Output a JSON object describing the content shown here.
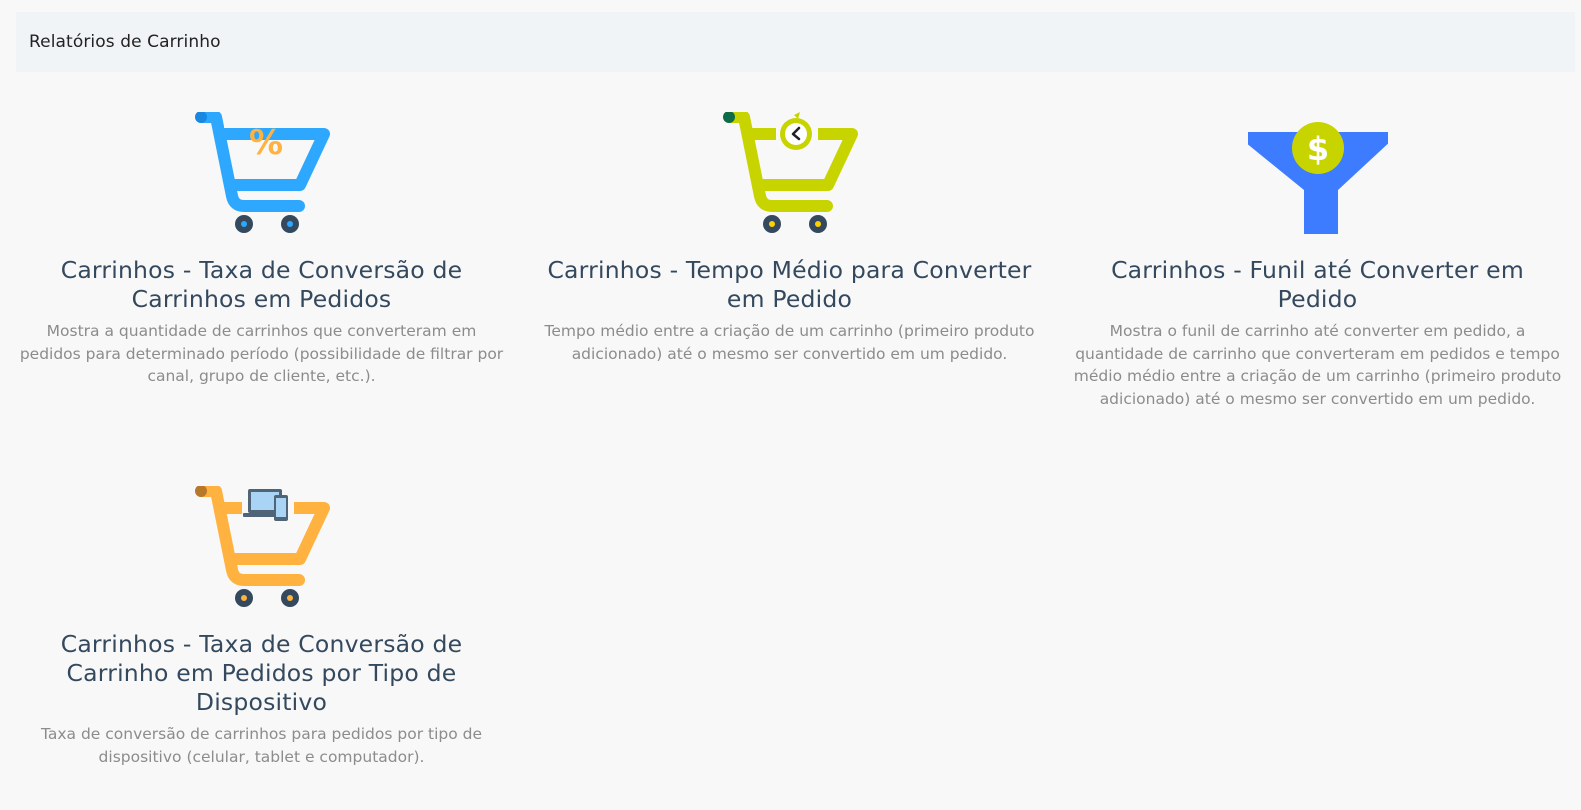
{
  "header": {
    "title": "Relatórios de Carrinho"
  },
  "cards": [
    {
      "title": "Carrinhos - Taxa de Conversão de Carrinhos em Pedidos",
      "description": "Mostra a quantidade de carrinhos que converteram em pedidos para determinado período (possibilidade de filtrar por canal, grupo de cliente, etc.).",
      "icon": "cart-percent-icon",
      "color": "#2ea8ff"
    },
    {
      "title": "Carrinhos - Tempo Médio para Converter em Pedido",
      "description": "Tempo médio entre a criação de um carrinho (primeiro produto adicionado) até o mesmo ser convertido em um pedido.",
      "icon": "cart-clock-icon",
      "color": "#c8d400"
    },
    {
      "title": "Carrinhos - Funil até Converter em Pedido",
      "description": "Mostra o funil de carrinho até converter em pedido, a quantidade de carrinho que converteram em pedidos e tempo médio médio entre a criação de um carrinho (primeiro produto adicionado) até o mesmo ser convertido em um pedido.",
      "icon": "funnel-dollar-icon",
      "color": "#3d7bff"
    },
    {
      "title": "Carrinhos - Taxa de Conversão de Carrinho em Pedidos por Tipo de Dispositivo",
      "description": "Taxa de conversão de carrinhos para pedidos por tipo de dispositivo (celular, tablet e computador).",
      "icon": "cart-devices-icon",
      "color": "#ffb23f"
    }
  ],
  "icon_symbols": {
    "percent": "%",
    "dollar": "$"
  }
}
